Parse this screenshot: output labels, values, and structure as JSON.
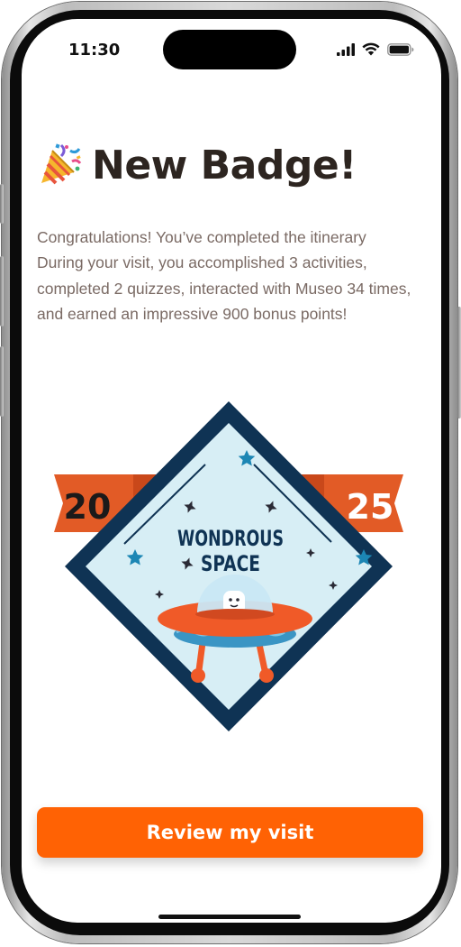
{
  "status_bar": {
    "time": "11:30"
  },
  "screen": {
    "title": "New Badge!",
    "title_icon": "party-popper-icon",
    "body": "Congratulations! You’ve completed the itinerary During your visit, you accomplished 3 activities, completed 2 quizzes, interacted with Museo 34 times, and earned an impressive 900 bonus points!"
  },
  "badge": {
    "year_left": "20",
    "year_right": "25",
    "line1": "WONDROUS",
    "line2": "SPACE",
    "colors": {
      "frame": "#0f3354",
      "inner": "#d7eef5",
      "ribbon": "#e25b26",
      "ufo": "#f05a28",
      "ufo_base": "#3a95c4"
    }
  },
  "cta": {
    "label": "Review my visit",
    "color": "#ff6204"
  }
}
